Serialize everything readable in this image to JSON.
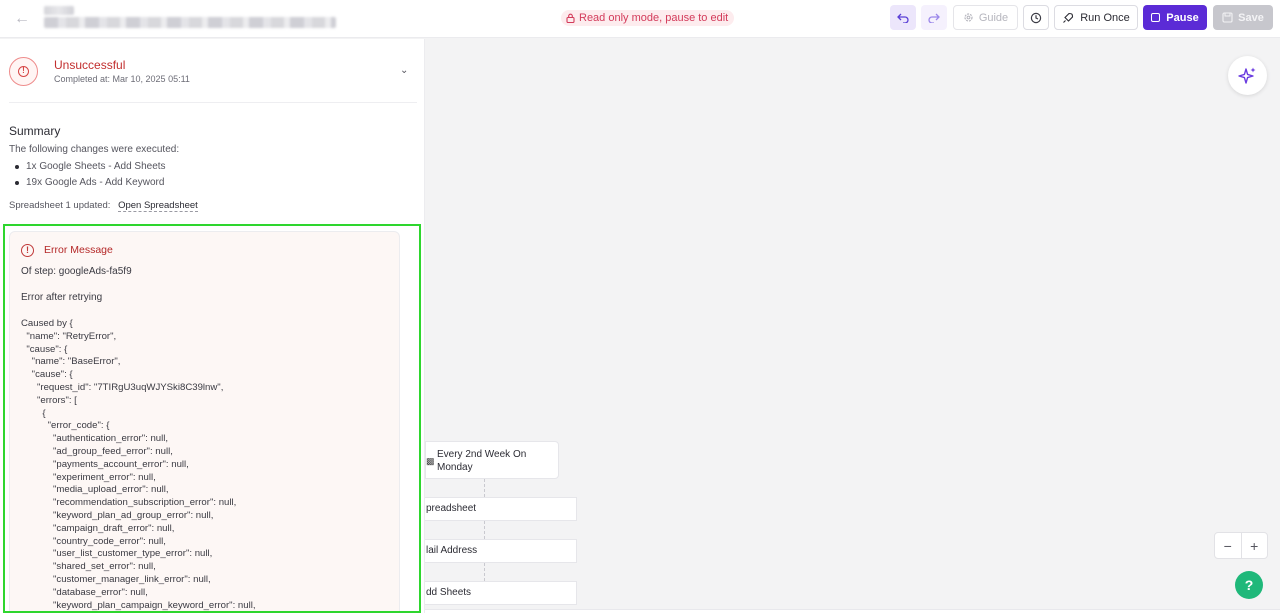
{
  "header": {
    "back_icon": "arrow-left-icon",
    "readonly_label": "Read only mode, pause to edit",
    "guide_label": "Guide",
    "run_once_label": "Run Once",
    "pause_label": "Pause",
    "save_label": "Save",
    "accent_color": "#5b2bd6"
  },
  "status": {
    "title": "Unsuccessful",
    "completed": "Completed at: Mar 10, 2025 05:11"
  },
  "summary": {
    "title": "Summary",
    "intro": "The following changes were executed:",
    "items": [
      "1x Google Sheets - Add Sheets",
      "19x Google Ads - Add Keyword"
    ],
    "sheet_label": "Spreadsheet 1 updated:",
    "sheet_link": "Open Spreadsheet"
  },
  "error": {
    "title": "Error Message",
    "step": "Of step: googleAds-fa5f9",
    "retry": "Error after retrying",
    "details": "Caused by {\n  \"name\": \"RetryError\",\n  \"cause\": {\n    \"name\": \"BaseError\",\n    \"cause\": {\n      \"request_id\": \"7TIRgU3uqWJYSki8C39lnw\",\n      \"errors\": [\n        {\n          \"error_code\": {\n            \"authentication_error\": null,\n            \"ad_group_feed_error\": null,\n            \"payments_account_error\": null,\n            \"experiment_error\": null,\n            \"media_upload_error\": null,\n            \"recommendation_subscription_error\": null,\n            \"keyword_plan_ad_group_error\": null,\n            \"campaign_draft_error\": null,\n            \"country_code_error\": null,\n            \"user_list_customer_type_error\": null,\n            \"shared_set_error\": null,\n            \"customer_manager_link_error\": null,\n            \"database_error\": null,\n            \"keyword_plan_campaign_keyword_error\": null,"
  },
  "canvas": {
    "nodes": [
      "Every 2nd Week On Monday",
      "preadsheet",
      "lail Address",
      "dd Sheets"
    ],
    "zoom_out": "−",
    "zoom_in": "+",
    "help": "?"
  }
}
